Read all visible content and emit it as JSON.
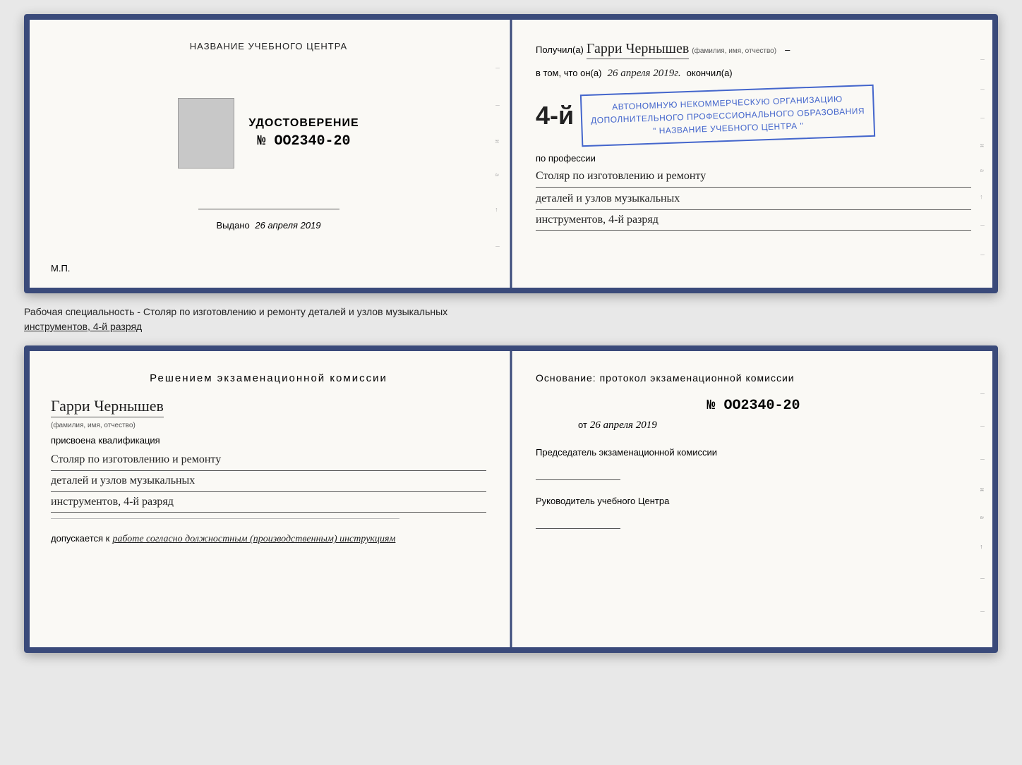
{
  "top_spread": {
    "left": {
      "org_name": "НАЗВАНИЕ УЧЕБНОГО ЦЕНТРА",
      "cert_label": "УДОСТОВЕРЕНИЕ",
      "cert_number": "№ OO2340-20",
      "issued_label": "Выдано",
      "issued_date": "26 апреля 2019",
      "mp_label": "М.П."
    },
    "right": {
      "poluchil_prefix": "Получил(а)",
      "recipient_name": "Гарри Чернышев",
      "fio_sub": "(фамилия, имя, отчество)",
      "dash": "–",
      "vtom_prefix": "в том, что он(а)",
      "date_handwritten": "26 апреля 2019г.",
      "okonchil": "окончил(а)",
      "grade": "4-й",
      "org_line1": "АВТОНОМНУЮ НЕКОММЕРЧЕСКУЮ ОРГАНИЗАЦИЮ",
      "org_line2": "ДОПОЛНИТЕЛЬНОГО ПРОФЕССИОНАЛЬНОГО ОБРАЗОВАНИЯ",
      "org_line3": "\" НАЗВАНИЕ УЧЕБНОГО ЦЕНТРА \"",
      "po_professii": "по профессии",
      "prof_line1": "Столяр по изготовлению и ремонту",
      "prof_line2": "деталей и узлов музыкальных",
      "prof_line3": "инструментов, 4-й разряд"
    }
  },
  "caption": {
    "text": "Рабочая специальность - Столяр по изготовлению и ремонту деталей и узлов музыкальных",
    "text2": "инструментов, 4-й разряд"
  },
  "bottom_spread": {
    "left": {
      "decision_title": "Решением  экзаменационной  комиссии",
      "name_handwritten": "Гарри Чернышев",
      "fio_sub": "(фамилия, имя, отчество)",
      "prisvoena": "присвоена квалификация",
      "qual_line1": "Столяр по изготовлению и ремонту",
      "qual_line2": "деталей и узлов музыкальных",
      "qual_line3": "инструментов, 4-й разряд",
      "dopuskaetsya_label": "допускается к",
      "dopusk_text": "работе согласно должностным (производственным) инструкциям"
    },
    "right": {
      "osnovaniye": "Основание: протокол экзаменационной  комиссии",
      "protocol_number": "№  OO2340-20",
      "ot_label": "от",
      "ot_date": "26 апреля 2019",
      "chairman_label": "Председатель экзаменационной комиссии",
      "rukovoditel_label": "Руководитель учебного Центра"
    }
  }
}
